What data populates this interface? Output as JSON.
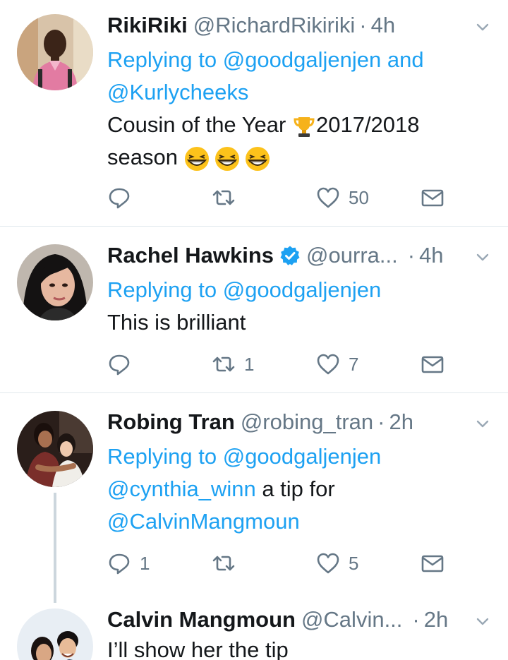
{
  "tweets": [
    {
      "name": "RikiRiki",
      "handle": "@RichardRikiriki",
      "dot": "·",
      "time": "4h",
      "replying_prefix": "Replying to",
      "replying_1": "@goodgaljenjen",
      "replying_and": "and",
      "replying_2": "@Kurlycheeks",
      "text_1a": "Cousin of the Year",
      "text_1b": "2017/2018",
      "text_2": "season",
      "reply_count": "",
      "retweet_count": "",
      "like_count": "50"
    },
    {
      "name": "Rachel Hawkins",
      "handle": "@ourra...",
      "dot": "·",
      "time": "4h",
      "replying_prefix": "Replying to",
      "replying_1": "@goodgaljenjen",
      "text_1": "This is brilliant",
      "reply_count": "",
      "retweet_count": "1",
      "like_count": "7"
    },
    {
      "name": "Robing Tran",
      "handle": "@robing_tran",
      "dot": "·",
      "time": "2h",
      "replying_prefix": "Replying to",
      "replying_1": "@goodgaljenjen",
      "mention_1": "@cynthia_winn",
      "text_mid": "a tip for",
      "mention_2": "@CalvinMangmoun",
      "reply_count": "1",
      "retweet_count": "",
      "like_count": "5"
    },
    {
      "name": "Calvin Mangmoun",
      "handle": "@Calvin...",
      "dot": "·",
      "time": "2h",
      "text_1": "I’ll show her the tip"
    }
  ],
  "icons": {
    "reply": "reply-icon",
    "retweet": "retweet-icon",
    "like": "heart-icon",
    "dm": "envelope-icon",
    "more": "chevron-down-icon",
    "verified": "verified-badge-icon",
    "trophy": "trophy-emoji",
    "laugh": "grinning-squinting-face-emoji"
  },
  "colors": {
    "link": "#1da1f2",
    "text": "#14171a",
    "secondary": "#657786",
    "divider": "#e1e8ed",
    "thread_line": "#ccd6dd",
    "verified": "#1da1f2"
  }
}
